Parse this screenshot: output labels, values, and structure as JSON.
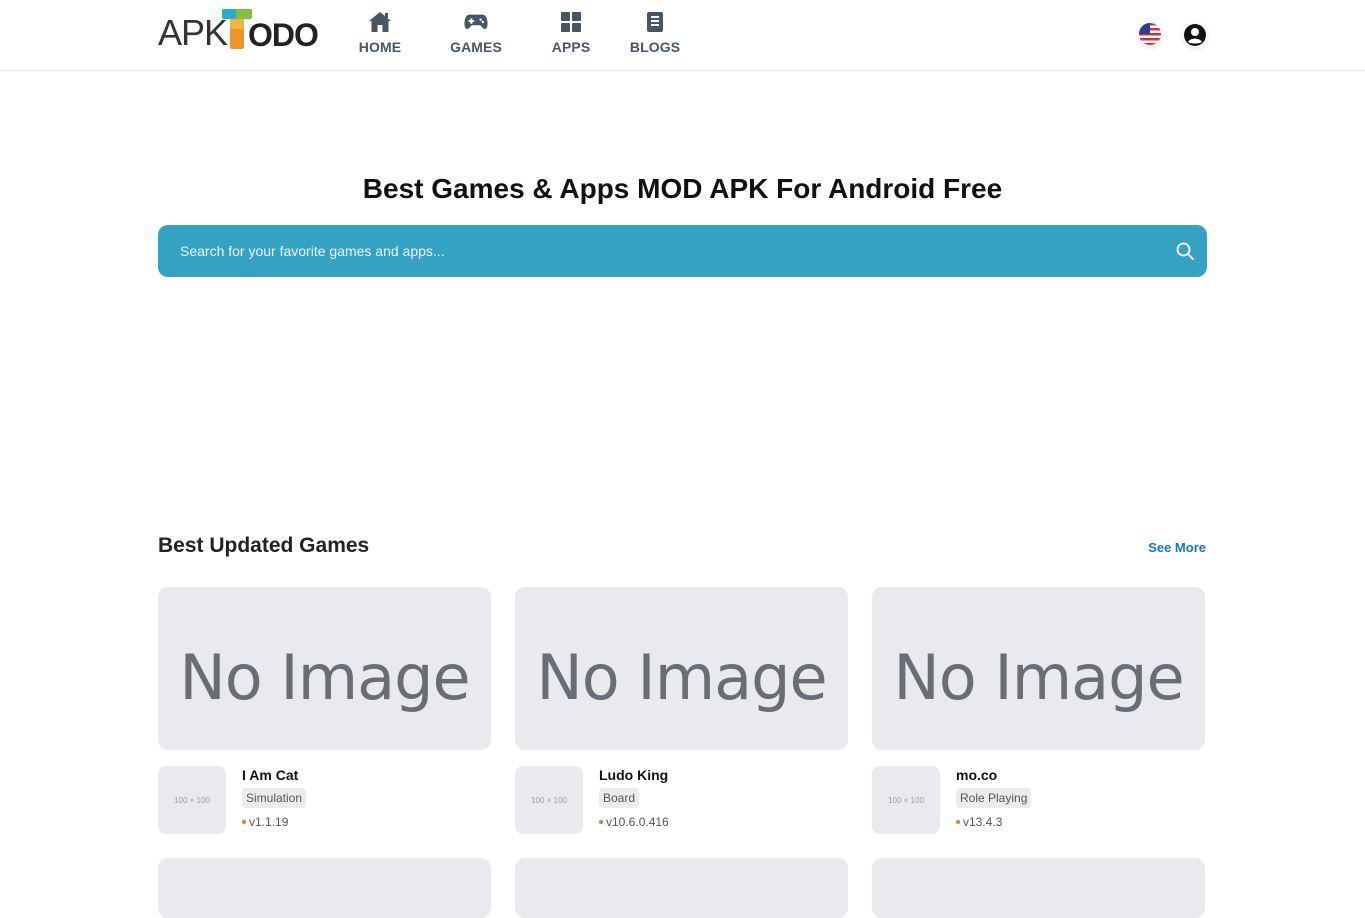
{
  "header": {
    "logo": {
      "part1": "APK",
      "part2": "ODO"
    },
    "nav": [
      {
        "label": "HOME",
        "icon": "home-icon"
      },
      {
        "label": "GAMES",
        "icon": "gamepad-icon"
      },
      {
        "label": "APPS",
        "icon": "apps-grid-icon"
      },
      {
        "label": "BLOGS",
        "icon": "blog-icon"
      }
    ],
    "language_icon": "us-flag-icon",
    "account_icon": "user-circle-icon"
  },
  "hero": {
    "title": "Best Games & Apps MOD APK For Android Free",
    "search_placeholder": "Search for your favorite games and apps..."
  },
  "section": {
    "title": "Best Updated Games",
    "see_more": "See More",
    "cover_placeholder": "No Image",
    "thumb_placeholder": "100 × 100",
    "games": [
      {
        "name": "I Am Cat",
        "category": "Simulation",
        "version": "v1.1.19"
      },
      {
        "name": "Ludo King",
        "category": "Board",
        "version": "v10.6.0.416"
      },
      {
        "name": "mo.co",
        "category": "Role Playing",
        "version": "v13.4.3"
      }
    ]
  },
  "colors": {
    "search_bg": "#35a2c2",
    "nav_text": "#4a5563",
    "link": "#1a73c4",
    "version_dot": "#f07a1e"
  }
}
